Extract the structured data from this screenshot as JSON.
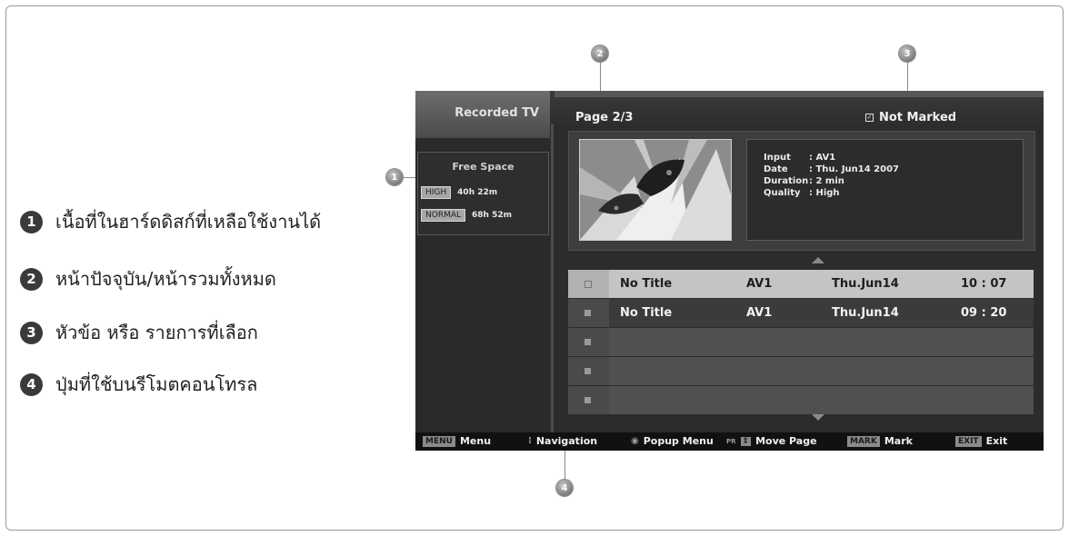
{
  "legend": [
    {
      "num": "1",
      "text": "เนื้อที่ในฮาร์ดดิสก์ที่เหลือใช้งานได้"
    },
    {
      "num": "2",
      "text": "หน้าปัจจุบัน/หน้ารวมทั้งหมด"
    },
    {
      "num": "3",
      "text": "หัวข้อ หรือ รายการที่เลือก"
    },
    {
      "num": "4",
      "text": "ปุ่มที่ใช้บนรีโมตคอนโทรล"
    }
  ],
  "callouts": {
    "c1": "1",
    "c2": "2",
    "c3": "3",
    "c4": "4"
  },
  "tv": {
    "tab_title": "Recorded TV",
    "page_label": "Page 2/3",
    "marked_icon": "checkbox-icon",
    "marked_label": "Not Marked",
    "free_space": {
      "title": "Free Space",
      "high": {
        "badge": "HIGH",
        "time": "40h 22m"
      },
      "normal": {
        "badge": "NORMAL",
        "time": "68h 52m"
      }
    },
    "info": {
      "input_key": "Input",
      "input_val": ": AV1",
      "date_key": "Date",
      "date_val": ": Thu. Jun14 2007",
      "duration_key": "Duration",
      "duration_val": ": 2 min",
      "quality_key": "Quality",
      "quality_val": ": High"
    },
    "list": [
      {
        "title": "No Title",
        "input": "AV1",
        "date": "Thu.Jun14",
        "time": "10 : 07"
      },
      {
        "title": "No Title",
        "input": "AV1",
        "date": "Thu.Jun14",
        "time": "09 : 20"
      }
    ],
    "bottom": {
      "menu_key": "MENU",
      "menu_label": "Menu",
      "nav_label": "Navigation",
      "popup_label": "Popup Menu",
      "pr_key": "PR",
      "move_label": "Move Page",
      "mark_key": "MARK",
      "mark_label": "Mark",
      "exit_key": "EXIT",
      "exit_label": "Exit"
    }
  }
}
